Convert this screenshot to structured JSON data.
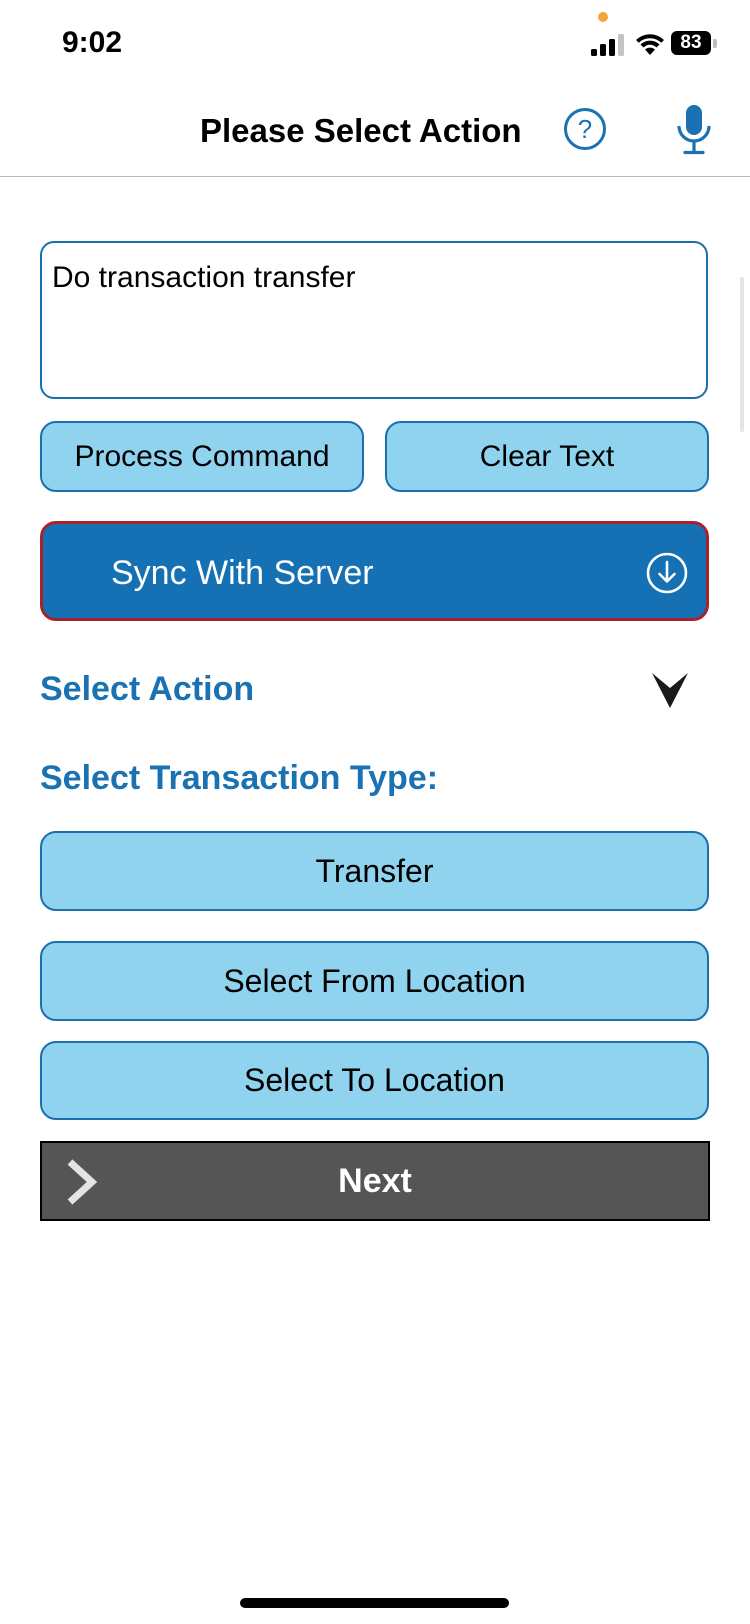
{
  "status_bar": {
    "time": "9:02",
    "battery_level": "83"
  },
  "nav": {
    "title": "Please Select Action"
  },
  "command": {
    "value": "Do transaction transfer"
  },
  "buttons": {
    "process_command": "Process Command",
    "clear_text": "Clear Text",
    "sync": "Sync With Server",
    "transfer": "Transfer",
    "select_from": "Select From Location",
    "select_to": "Select To Location",
    "next": "Next"
  },
  "labels": {
    "select_action": "Select Action",
    "select_transaction_type": "Select Transaction Type:"
  },
  "colors": {
    "accent": "#1a72b2",
    "button_fill": "#90d3ef",
    "sync_fill": "#1571b3",
    "sync_border": "#a8222c",
    "next_fill": "#555555"
  },
  "icons": {
    "help": "help-icon",
    "mic": "microphone-icon",
    "sync": "download-circle-icon",
    "dropdown": "chevron-down-icon",
    "next": "chevron-right-icon"
  }
}
